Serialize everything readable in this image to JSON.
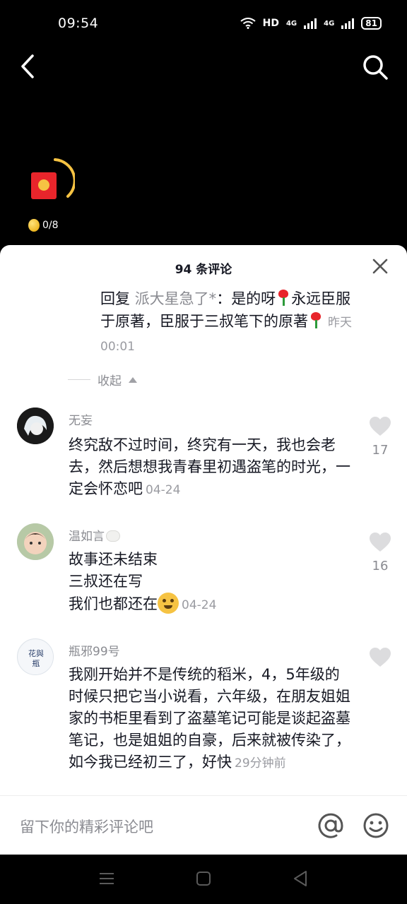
{
  "status_bar": {
    "time": "09:54",
    "network": "HD",
    "signal1": "4G",
    "signal2": "4G",
    "battery": "81"
  },
  "nav": {
    "back_icon": "chevron-left-icon",
    "search_icon": "search-icon"
  },
  "red_packet": {
    "coins_progress": "0/8",
    "progress_fraction": 0.3
  },
  "sheet": {
    "title": "94 条评论",
    "reply": {
      "prefix": "回复",
      "target": "派大星急了*",
      "sep": "：",
      "text1": "是的呀",
      "text2": "永远臣服于原著，臣服于三叔笔下的原著",
      "date": "昨天00:01"
    },
    "collapse_label": "收起",
    "comments": [
      {
        "username": "无妄",
        "text": "终究敌不过时间，终究有一天，我也会老去，然后想想我青春里初遇盗笔的时光，一定会怀恋吧",
        "date": "04-24",
        "likes": "17"
      },
      {
        "username": "温如言",
        "lines": [
          "故事还未结束",
          "三叔还在写",
          "我们也都还在"
        ],
        "date": "04-24",
        "likes": "16"
      },
      {
        "username": "瓶邪99号",
        "avatar_text": "花與瓶",
        "text": "我刚开始并不是传统的稻米，4，5年级的时候只把它当小说看，六年级，在朋友姐姐家的书柜里看到了盗墓笔记可能是谈起盗墓笔记，也是姐姐的自豪，后来就被传染了，如今我已经初三了，好快",
        "date": "29分钟前",
        "likes": ""
      }
    ]
  },
  "input_bar": {
    "placeholder": "留下你的精彩评论吧",
    "at_icon": "at-icon",
    "emoji_icon": "emoji-icon"
  },
  "colors": {
    "accent_red": "#e8252b",
    "muted_text": "#8a8b91",
    "body_text": "#161823"
  }
}
